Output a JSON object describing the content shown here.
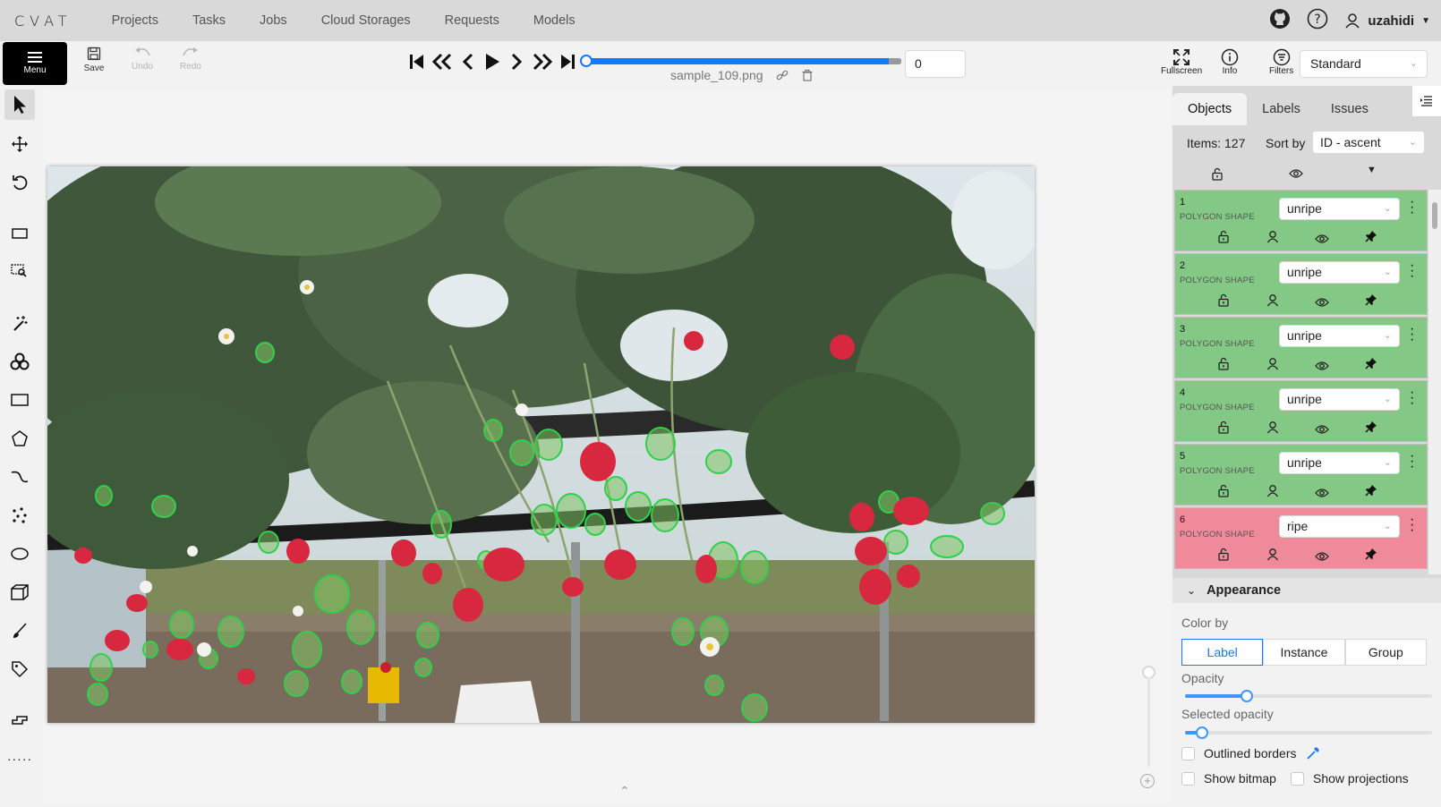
{
  "app": {
    "logo": "CVAT"
  },
  "nav": {
    "links": [
      "Projects",
      "Tasks",
      "Jobs",
      "Cloud Storages",
      "Requests",
      "Models"
    ],
    "username": "uzahidi"
  },
  "toolbar": {
    "menu_label": "Menu",
    "save_label": "Save",
    "undo_label": "Undo",
    "redo_label": "Redo",
    "filename": "sample_109.png",
    "frame_number": "0",
    "frame_progress": 0.0,
    "fullscreen_label": "Fullscreen",
    "info_label": "Info",
    "filters_label": "Filters",
    "workspace": "Standard"
  },
  "sidebar": {
    "tabs": [
      "Objects",
      "Labels",
      "Issues"
    ],
    "items_count": "Items: 127",
    "sort_label": "Sort by",
    "sort_value": "ID - ascent",
    "objects": [
      {
        "id": "1",
        "type": "POLYGON SHAPE",
        "label": "unripe",
        "color": "#83c985"
      },
      {
        "id": "2",
        "type": "POLYGON SHAPE",
        "label": "unripe",
        "color": "#83c985"
      },
      {
        "id": "3",
        "type": "POLYGON SHAPE",
        "label": "unripe",
        "color": "#83c985"
      },
      {
        "id": "4",
        "type": "POLYGON SHAPE",
        "label": "unripe",
        "color": "#83c985"
      },
      {
        "id": "5",
        "type": "POLYGON SHAPE",
        "label": "unripe",
        "color": "#83c985"
      },
      {
        "id": "6",
        "type": "POLYGON SHAPE",
        "label": "ripe",
        "color": "#ee8a99"
      }
    ]
  },
  "appearance": {
    "title": "Appearance",
    "color_by_label": "Color by",
    "color_by_options": [
      "Label",
      "Instance",
      "Group"
    ],
    "color_by_selected": "Label",
    "opacity_label": "Opacity",
    "opacity_value": 0.25,
    "selected_opacity_label": "Selected opacity",
    "selected_opacity_value": 0.07,
    "outlined_borders_label": "Outlined borders",
    "show_bitmap_label": "Show bitmap",
    "show_projections_label": "Show projections"
  },
  "colors": {
    "accent": "#1677ff",
    "unripe": "#83c985",
    "ripe": "#ee8a99",
    "topbar": "#d9d9d9"
  }
}
